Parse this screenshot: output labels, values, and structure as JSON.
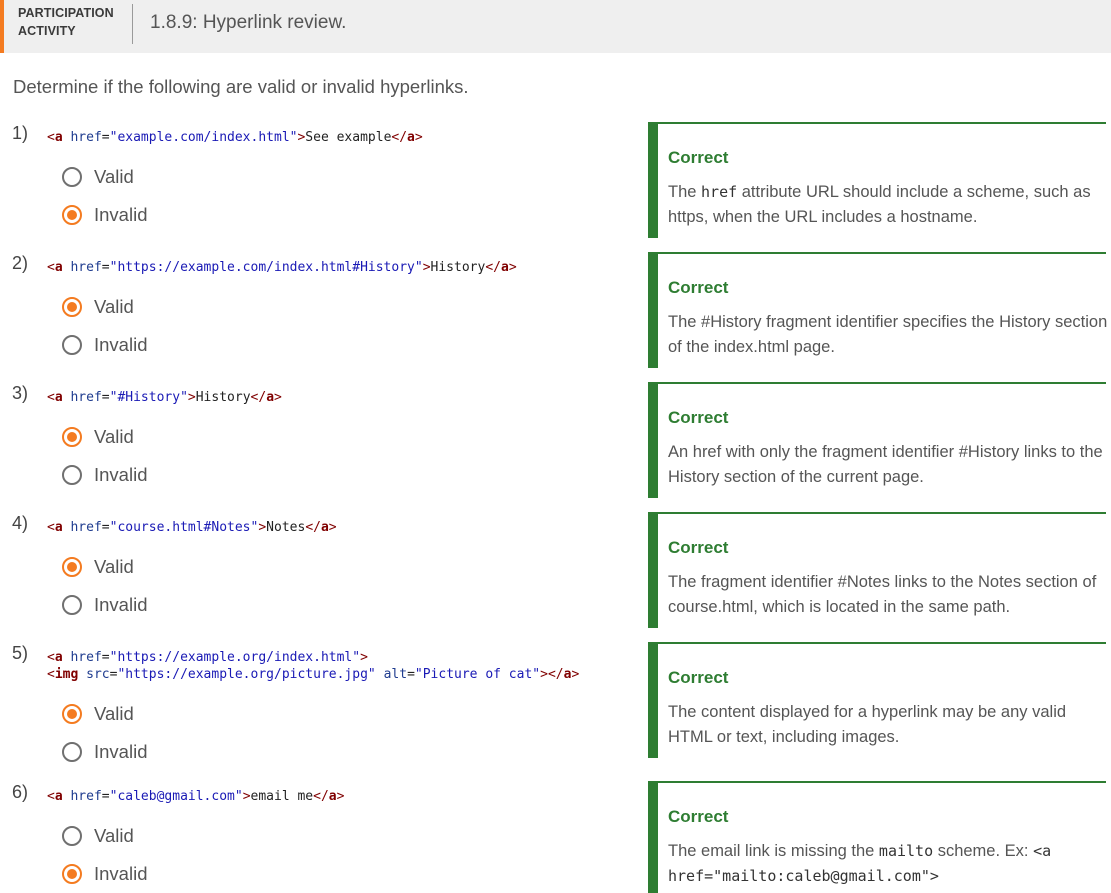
{
  "header": {
    "label_line1": "PARTICIPATION",
    "label_line2": "ACTIVITY",
    "title": "1.8.9: Hyperlink review."
  },
  "instructions": "Determine if the following are valid or invalid hyperlinks.",
  "options": {
    "valid": "Valid",
    "invalid": "Invalid"
  },
  "colors": {
    "accent": "#f47b20",
    "correct": "#2e7d32"
  },
  "questions": [
    {
      "number": "1)",
      "href": "example.com/index.html",
      "content": "See example",
      "selected": "Invalid",
      "feedback": {
        "status": "Correct",
        "text_before": "The ",
        "code": "href",
        "text_after": " attribute URL should include a scheme, such as https, when the URL includes a hostname."
      }
    },
    {
      "number": "2)",
      "href": "https://example.com/index.html#History",
      "content": "History",
      "selected": "Valid",
      "feedback": {
        "status": "Correct",
        "text": "The #History fragment identifier specifies the History section of the index.html page."
      }
    },
    {
      "number": "3)",
      "href": "#History",
      "content": "History",
      "selected": "Valid",
      "feedback": {
        "status": "Correct",
        "text": "An href with only the fragment identifier #History links to the History section of the current page."
      }
    },
    {
      "number": "4)",
      "href": "course.html#Notes",
      "content": "Notes",
      "selected": "Valid",
      "feedback": {
        "status": "Correct",
        "text": "The fragment identifier #Notes links to the Notes section of course.html, which is located in the same path."
      }
    },
    {
      "number": "5)",
      "href": "https://example.org/index.html",
      "img_src": "https://example.org/picture.jpg",
      "img_alt": "Picture of cat",
      "selected": "Valid",
      "feedback": {
        "status": "Correct",
        "text": "The content displayed for a hyperlink may be any valid HTML or text, including images."
      }
    },
    {
      "number": "6)",
      "href": "caleb@gmail.com",
      "content": "email me",
      "selected": "Invalid",
      "feedback": {
        "status": "Correct",
        "text_before": "The email link is missing the ",
        "code": "mailto",
        "text_middle": " scheme. Ex: ",
        "code_example": "<a href=\"mailto:caleb@gmail.com\">"
      }
    }
  ]
}
